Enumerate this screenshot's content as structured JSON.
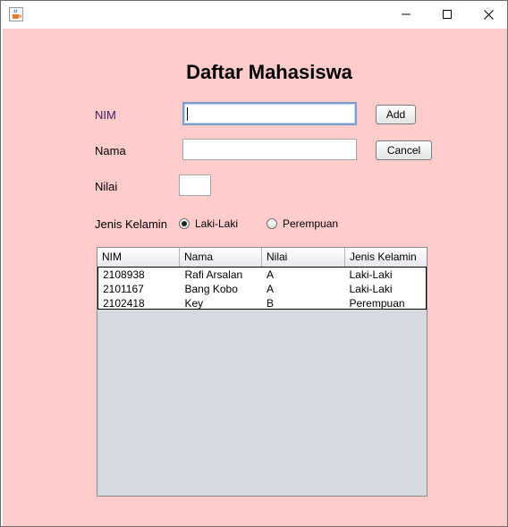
{
  "window": {
    "title": ""
  },
  "form": {
    "heading": "Daftar Mahasiswa",
    "nim_label": "NIM",
    "nama_label": "Nama",
    "nilai_label": "Nilai",
    "gender_label": "Jenis Kelamin",
    "nim_value": "",
    "nama_value": "",
    "nilai_value": "",
    "add_label": "Add",
    "cancel_label": "Cancel",
    "gender_options": [
      "Laki-Laki",
      "Perempuan"
    ],
    "gender_selected": "Laki-Laki"
  },
  "table": {
    "columns": [
      "NIM",
      "Nama",
      "Nilai",
      "Jenis Kelamin"
    ],
    "rows": [
      [
        "2108938",
        "Rafi Arsalan",
        "A",
        "Laki-Laki"
      ],
      [
        "2101167",
        "Bang Kobo",
        "A",
        "Laki-Laki"
      ],
      [
        "2102418",
        "Key",
        "B",
        "Perempuan"
      ]
    ]
  },
  "colors": {
    "background": "#ffcccc",
    "table_empty": "#d6d9e0"
  },
  "icons": {
    "app": "java-cup-icon",
    "minimize": "minimize-icon",
    "maximize": "maximize-icon",
    "close": "close-icon"
  }
}
